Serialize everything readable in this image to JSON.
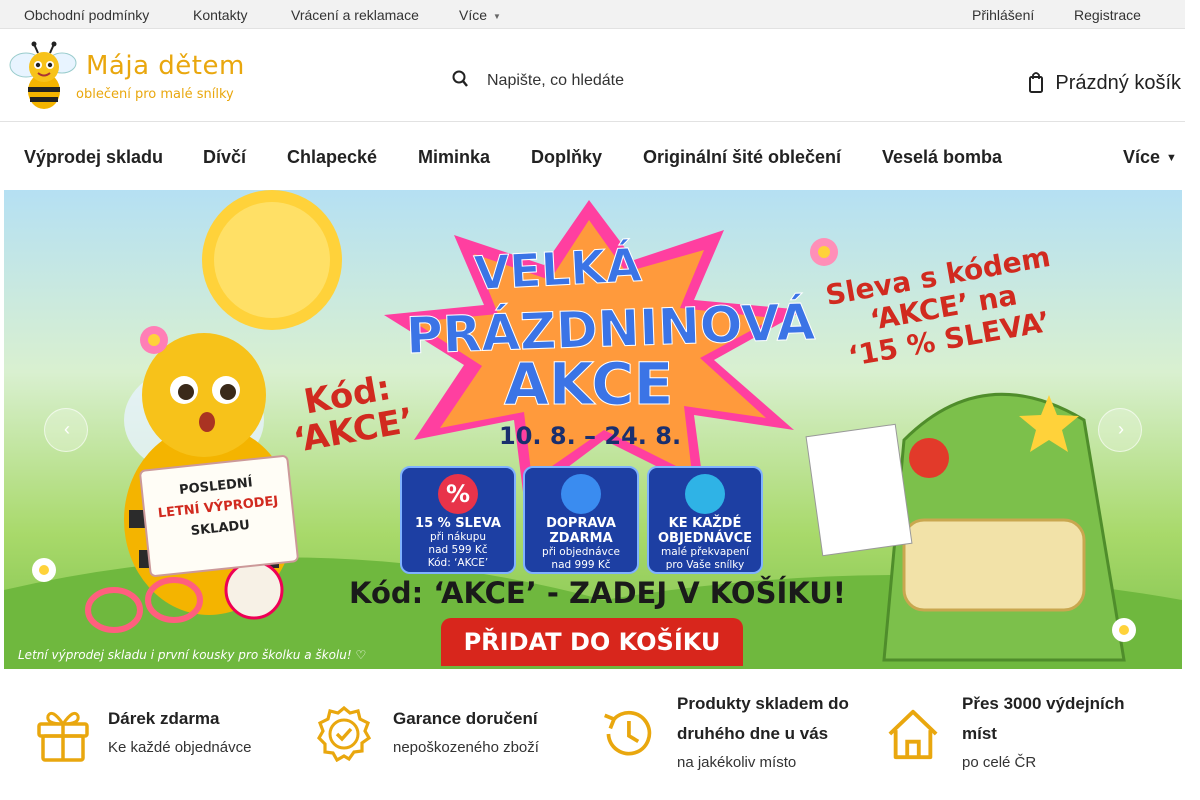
{
  "topbar": {
    "links": [
      "Obchodní podmínky",
      "Kontakty",
      "Vrácení a reklamace"
    ],
    "more_label": "Více",
    "login": "Přihlášení",
    "register": "Registrace"
  },
  "header": {
    "logo_title": "Mája dětem",
    "logo_subtitle": "oblečení pro malé snílky",
    "search_placeholder": "Napište, co hledáte",
    "cart_label": "Prázdný košík"
  },
  "nav": {
    "items": [
      "Výprodej skladu",
      "Dívčí",
      "Chlapecké",
      "Miminka",
      "Doplňky",
      "Originální šité oblečení",
      "Veselá bomba"
    ],
    "more_label": "Více"
  },
  "banner": {
    "title_line1": "VELKÁ",
    "title_line2": "PRÁZDNINOVÁ",
    "title_line3": "AKCE",
    "dates": "10. 8. – 24. 8.",
    "code_line1": "Kód:",
    "code_line2": "‘AKCE’",
    "discount_line1": "Sleva s kódem",
    "discount_line2": "‘AKCE’ na",
    "discount_line3": "‘15 % SLEVA’",
    "sign_line1": "POSLEDNÍ",
    "sign_line2": "LETNÍ VÝPRODEJ",
    "sign_line3": "SKLADU",
    "boxes": [
      {
        "title1": "15 % SLEVA",
        "title2": "",
        "sub1": "při nákupu",
        "sub2": "nad 599 Kč",
        "sub3": "Kód: ‘AKCE’"
      },
      {
        "title1": "DOPRAVA",
        "title2": "ZDARMA",
        "sub1": "při objednávce",
        "sub2": "nad 999 Kč",
        "sub3": ""
      },
      {
        "title1": "KE KAŽDÉ",
        "title2": "OBJEDNÁVCE",
        "sub1": "malé překvapení",
        "sub2": "pro Vaše snílky",
        "sub3": ""
      }
    ],
    "cta_line": "Kód: ‘AKCE’ - ZADEJ V KOŠÍKU!",
    "cta_button": "PŘIDAT DO KOŠÍKU",
    "footer_text": "Letní výprodej skladu i první kousky pro školku a školu! ♡"
  },
  "benefits": [
    {
      "title": "Dárek zdarma",
      "subtitle": "Ke každé objednávce"
    },
    {
      "title": "Garance doručení",
      "subtitle": "nepoškozeného zboží"
    },
    {
      "title_line1": "Produkty skladem do",
      "title_line2": "druhého dne u vás",
      "subtitle": "na jakékoliv místo"
    },
    {
      "title_line1": "Přes 3000 výdejních",
      "title_line2": "míst",
      "subtitle": "po celé ČR"
    }
  ],
  "colors": {
    "accent_gold": "#e9a70e",
    "banner_blue": "#3b74e6",
    "banner_red": "#d8261c"
  }
}
